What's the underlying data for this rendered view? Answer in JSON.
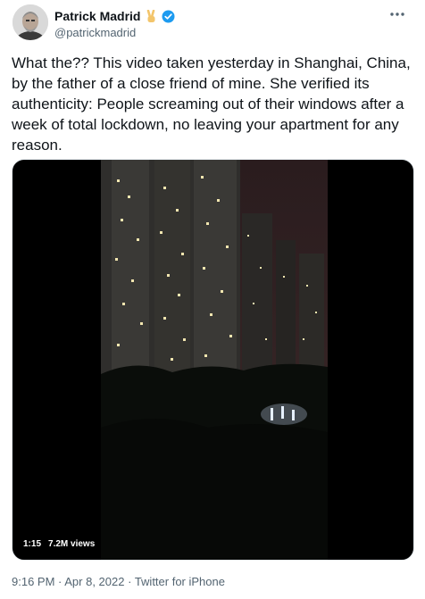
{
  "author": {
    "display_name": "Patrick Madrid",
    "handle": "@patrickmadrid",
    "emoji_icon": "victory-hand-emoji",
    "verified_icon": "verified-badge-icon",
    "verified_color": "#1d9bf0"
  },
  "tweet": {
    "text": "What the?? This video taken yesterday in Shanghai, China, by the father of a close friend of mine. She verified its authenticity: People screaming out of their windows after a week of total lockdown, no leaving your apartment for any reason."
  },
  "video": {
    "duration": "1:15",
    "views": "7.2M views"
  },
  "meta": {
    "time": "9:16 PM",
    "separator": " · ",
    "date": "Apr 8, 2022",
    "source": "Twitter for iPhone"
  }
}
